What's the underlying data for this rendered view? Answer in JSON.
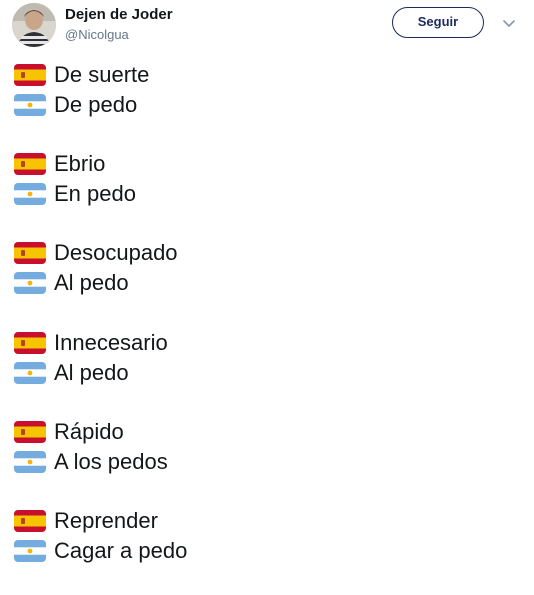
{
  "tweet": {
    "author": {
      "display_name": "Dejen de Joder",
      "handle": "@Nicolgua"
    },
    "follow_label": "Seguir",
    "more_icon": "chevron-down-icon",
    "lines": [
      {
        "spain": "De suerte",
        "argentina": "De pedo"
      },
      {
        "spain": "Ebrio",
        "argentina": "En pedo"
      },
      {
        "spain": "Desocupado",
        "argentina": "Al pedo"
      },
      {
        "spain": "Innecesario",
        "argentina": "Al pedo"
      },
      {
        "spain": "Rápido",
        "argentina": "A los pedos"
      },
      {
        "spain": "Reprender",
        "argentina": "Cagar a pedo"
      }
    ]
  },
  "icons": {
    "spain_flag": "spain-flag-icon",
    "argentina_flag": "argentina-flag-icon"
  },
  "colors": {
    "follow_border": "#1c2a5e",
    "handle": "#657786",
    "spain_red": "#c8102e",
    "spain_yellow": "#f6c400",
    "argentina_blue": "#74acdf",
    "argentina_sun": "#f6b40e"
  }
}
